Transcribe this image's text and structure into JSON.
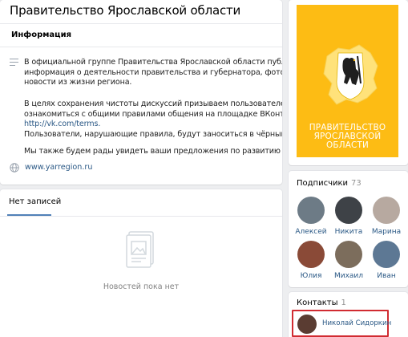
{
  "group": {
    "title": "Правительство Ярославской области"
  },
  "info": {
    "heading": "Информация",
    "description_icon": "text-lines-icon",
    "p1_lines": [
      "В официальной группе Правительства Ярославской области публикуется",
      "информация о деятельности правительства и губернатора, фотоматериалы и",
      "новости из жизни региона."
    ],
    "p2_lines": [
      "В целях сохранения чистоты дискуссий призываем пользователей",
      "ознакомиться с общими правилами общения на площадке ВКонтакте"
    ],
    "rules_link": "http://vk.com/terms.",
    "p2_line4": "Пользователи, нарушающие правила, будут заноситься в чёрный список.",
    "p3": "Мы также будем рады увидеть ваши предложения по развитию группы.",
    "website_icon": "globe-icon",
    "website": "www.yarregion.ru"
  },
  "wall": {
    "tab_label": "Нет записей",
    "empty_icon": "photo-stack-icon",
    "empty_text": "Новостей пока нет"
  },
  "cover": {
    "text": "ПРАВИТЕЛЬСТВО\nЯРОСЛАВСКОЙ\nОБЛАСТИ",
    "background": "#fdbc14"
  },
  "subscribers": {
    "title": "Подписчики",
    "count": "73",
    "people": [
      {
        "name": "Алексей",
        "color": "#6d7b86"
      },
      {
        "name": "Никита",
        "color": "#3e4247"
      },
      {
        "name": "Марина",
        "color": "#b7a9a0"
      },
      {
        "name": "Юлия",
        "color": "#8a4a37"
      },
      {
        "name": "Михаил",
        "color": "#7c6d5c"
      },
      {
        "name": "Иван",
        "color": "#5d7894"
      }
    ]
  },
  "contacts": {
    "title": "Контакты",
    "count": "1",
    "person_name": "Николай Сидоркин",
    "person_color": "#5a3c32",
    "highlight_color": "#d12b31"
  },
  "colors": {
    "link": "#2a5885",
    "accent": "#5181b8"
  }
}
